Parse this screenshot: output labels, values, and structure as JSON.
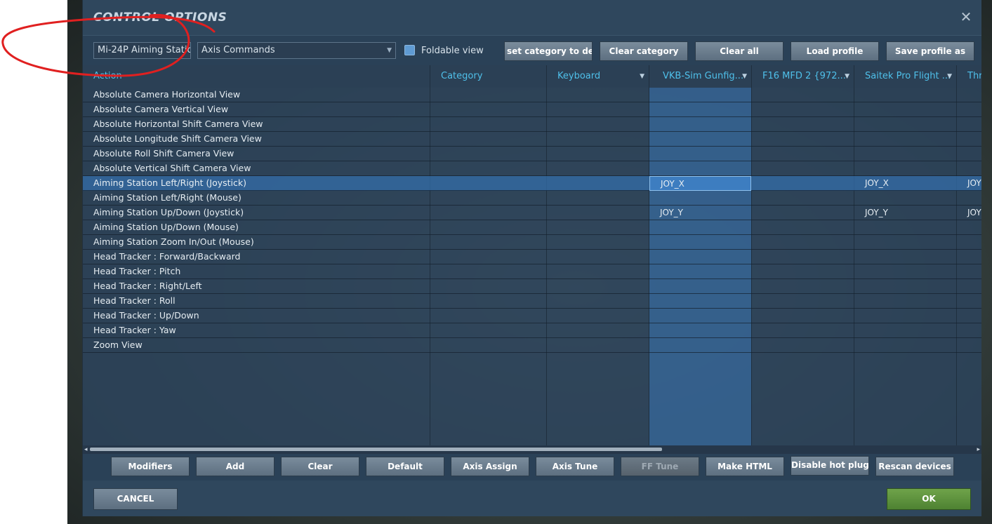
{
  "dialog": {
    "title": "CONTROL OPTIONS",
    "close_glyph": "✕"
  },
  "toolbar": {
    "aircraft_select": "Mi-24P Aiming Statio",
    "category_select": "Axis Commands",
    "dropdown_arrow": "▼",
    "foldable_label": "Foldable view",
    "foldable_checked": true,
    "buttons": {
      "reset_category": "set category to defa",
      "clear_category": "Clear category",
      "clear_all": "Clear all",
      "load_profile": "Load profile",
      "save_profile": "Save profile as"
    }
  },
  "columns": {
    "action": "Action",
    "category": "Category",
    "keyboard": "Keyboard",
    "vkb": "VKB-Sim Gunfig...",
    "f16mfd": "F16 MFD 2 {972...",
    "saitek": "Saitek Pro Flight ...",
    "thr": "Thr"
  },
  "rows": [
    {
      "action": "Absolute Camera Horizontal View",
      "vkb": "",
      "saitek": "",
      "thr": ""
    },
    {
      "action": "Absolute Camera Vertical View",
      "vkb": "",
      "saitek": "",
      "thr": ""
    },
    {
      "action": "Absolute Horizontal Shift Camera View",
      "vkb": "",
      "saitek": "",
      "thr": ""
    },
    {
      "action": "Absolute Longitude Shift Camera View",
      "vkb": "",
      "saitek": "",
      "thr": ""
    },
    {
      "action": "Absolute Roll Shift Camera View",
      "vkb": "",
      "saitek": "",
      "thr": ""
    },
    {
      "action": "Absolute Vertical Shift Camera View",
      "vkb": "",
      "saitek": "",
      "thr": ""
    },
    {
      "action": "Aiming Station Left/Right (Joystick)",
      "vkb": "JOY_X",
      "saitek": "JOY_X",
      "thr": "JOY",
      "selected": true
    },
    {
      "action": "Aiming Station Left/Right (Mouse)",
      "vkb": "",
      "saitek": "",
      "thr": ""
    },
    {
      "action": "Aiming Station Up/Down (Joystick)",
      "vkb": "JOY_Y",
      "saitek": "JOY_Y",
      "thr": "JOY"
    },
    {
      "action": "Aiming Station Up/Down (Mouse)",
      "vkb": "",
      "saitek": "",
      "thr": ""
    },
    {
      "action": "Aiming Station Zoom In/Out (Mouse)",
      "vkb": "",
      "saitek": "",
      "thr": ""
    },
    {
      "action": "Head Tracker : Forward/Backward",
      "vkb": "",
      "saitek": "",
      "thr": ""
    },
    {
      "action": "Head Tracker : Pitch",
      "vkb": "",
      "saitek": "",
      "thr": ""
    },
    {
      "action": "Head Tracker : Right/Left",
      "vkb": "",
      "saitek": "",
      "thr": ""
    },
    {
      "action": "Head Tracker : Roll",
      "vkb": "",
      "saitek": "",
      "thr": ""
    },
    {
      "action": "Head Tracker : Up/Down",
      "vkb": "",
      "saitek": "",
      "thr": ""
    },
    {
      "action": "Head Tracker : Yaw",
      "vkb": "",
      "saitek": "",
      "thr": ""
    },
    {
      "action": "Zoom View",
      "vkb": "",
      "saitek": "",
      "thr": ""
    }
  ],
  "scrollbar": {
    "left_glyph": "◂",
    "right_glyph": "▸"
  },
  "bottom_buttons": {
    "modifiers": "Modifiers",
    "add": "Add",
    "clear": "Clear",
    "default": "Default",
    "axis_assign": "Axis Assign",
    "axis_tune": "Axis Tune",
    "ff_tune": "FF Tune",
    "make_html": "Make HTML",
    "disable_hot_plug": "Disable hot plug",
    "rescan_devices": "Rescan devices"
  },
  "footer": {
    "cancel": "CANCEL",
    "ok": "OK"
  },
  "colors": {
    "accent_header": "#4fc0ea",
    "selected_row": "#346eaa",
    "ok_green": "#5f963e",
    "annotation_red": "#e02020"
  }
}
